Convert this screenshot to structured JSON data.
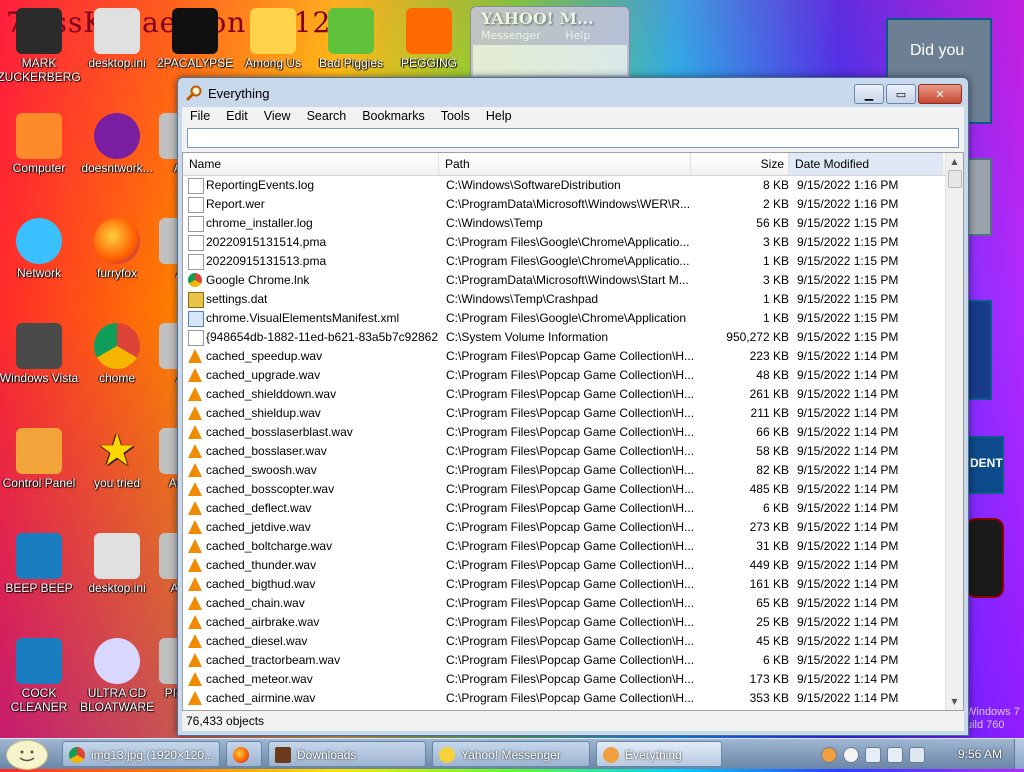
{
  "desktop": {
    "title_text": "7 ossKanae tion 2012",
    "icons": [
      {
        "label": "MARK ZUCKERBERG",
        "icon": "person-icon"
      },
      {
        "label": "desktop.ini",
        "icon": "settings-file-icon"
      },
      {
        "label": "2PACALYPSE",
        "icon": "cmd-icon"
      },
      {
        "label": "Among Us",
        "icon": "folder-icon"
      },
      {
        "label": "Bad Piggies",
        "icon": "pig-icon"
      },
      {
        "label": "PEGGING",
        "icon": "peggle-icon"
      },
      {
        "label": "Computer",
        "icon": "computer-icon"
      },
      {
        "label": "doesntwork...",
        "icon": "yahoo-icon"
      },
      {
        "label": "AN",
        "icon": "app-icon"
      },
      {
        "label": "Network",
        "icon": "network-icon"
      },
      {
        "label": "furryfox",
        "icon": "firefox-icon"
      },
      {
        "label": "Ar",
        "icon": "app-icon"
      },
      {
        "label": "Windows Vista",
        "icon": "recycle-bin-icon"
      },
      {
        "label": "chome",
        "icon": "chrome-icon"
      },
      {
        "label": "Ar",
        "icon": "app-icon"
      },
      {
        "label": "Control Panel",
        "icon": "control-panel-icon"
      },
      {
        "label": "you tried",
        "icon": "star-icon"
      },
      {
        "label": "Ar St",
        "icon": "app-icon"
      },
      {
        "label": "BEEP BEEP",
        "icon": "book-icon"
      },
      {
        "label": "desktop.ini",
        "icon": "settings-file-icon"
      },
      {
        "label": "Ar S",
        "icon": "app-icon"
      },
      {
        "label": "COCK CLEANER",
        "icon": "book-icon"
      },
      {
        "label": "ULTRA CD BLOATWARE",
        "icon": "cd-icon"
      },
      {
        "label": "PIS IN",
        "icon": "app-icon"
      }
    ],
    "right_texts": {
      "did_you": "Did you",
      "dent": "DENT",
      "win7": "Windows 7",
      "build": "uild 760"
    }
  },
  "yahoo_window": {
    "title": "YAHOO! M...",
    "menu": [
      "Messenger",
      "Help"
    ]
  },
  "window": {
    "title": "Everything",
    "menus": [
      "File",
      "Edit",
      "View",
      "Search",
      "Bookmarks",
      "Tools",
      "Help"
    ],
    "search": {
      "value": "",
      "placeholder": ""
    },
    "columns": {
      "name": "Name",
      "path": "Path",
      "size": "Size",
      "date": "Date Modified"
    },
    "rows": [
      {
        "name": "ReportingEvents.log",
        "path": "C:\\Windows\\SoftwareDistribution",
        "size": "8 KB",
        "date": "9/15/2022 1:16 PM",
        "icon": "log"
      },
      {
        "name": "Report.wer",
        "path": "C:\\ProgramData\\Microsoft\\Windows\\WER\\R...",
        "size": "2 KB",
        "date": "9/15/2022 1:16 PM",
        "icon": "log"
      },
      {
        "name": "chrome_installer.log",
        "path": "C:\\Windows\\Temp",
        "size": "56 KB",
        "date": "9/15/2022 1:15 PM",
        "icon": "log"
      },
      {
        "name": "20220915131514.pma",
        "path": "C:\\Program Files\\Google\\Chrome\\Applicatio...",
        "size": "3 KB",
        "date": "9/15/2022 1:15 PM",
        "icon": "log"
      },
      {
        "name": "20220915131513.pma",
        "path": "C:\\Program Files\\Google\\Chrome\\Applicatio...",
        "size": "1 KB",
        "date": "9/15/2022 1:15 PM",
        "icon": "log"
      },
      {
        "name": "Google Chrome.lnk",
        "path": "C:\\ProgramData\\Microsoft\\Windows\\Start M...",
        "size": "3 KB",
        "date": "9/15/2022 1:15 PM",
        "icon": "chrome"
      },
      {
        "name": "settings.dat",
        "path": "C:\\Windows\\Temp\\Crashpad",
        "size": "1 KB",
        "date": "9/15/2022 1:15 PM",
        "icon": "lock"
      },
      {
        "name": "chrome.VisualElementsManifest.xml",
        "path": "C:\\Program Files\\Google\\Chrome\\Application",
        "size": "1 KB",
        "date": "9/15/2022 1:15 PM",
        "icon": "xml"
      },
      {
        "name": "{948654db-1882-11ed-b621-83a5b7c92862...",
        "path": "C:\\System Volume Information",
        "size": "950,272 KB",
        "date": "9/15/2022 1:15 PM",
        "icon": "log"
      },
      {
        "name": "cached_speedup.wav",
        "path": "C:\\Program Files\\Popcap Game Collection\\H...",
        "size": "223 KB",
        "date": "9/15/2022 1:14 PM",
        "icon": "vlc"
      },
      {
        "name": "cached_upgrade.wav",
        "path": "C:\\Program Files\\Popcap Game Collection\\H...",
        "size": "48 KB",
        "date": "9/15/2022 1:14 PM",
        "icon": "vlc"
      },
      {
        "name": "cached_shielddown.wav",
        "path": "C:\\Program Files\\Popcap Game Collection\\H...",
        "size": "261 KB",
        "date": "9/15/2022 1:14 PM",
        "icon": "vlc"
      },
      {
        "name": "cached_shieldup.wav",
        "path": "C:\\Program Files\\Popcap Game Collection\\H...",
        "size": "211 KB",
        "date": "9/15/2022 1:14 PM",
        "icon": "vlc"
      },
      {
        "name": "cached_bosslaserblast.wav",
        "path": "C:\\Program Files\\Popcap Game Collection\\H...",
        "size": "66 KB",
        "date": "9/15/2022 1:14 PM",
        "icon": "vlc"
      },
      {
        "name": "cached_bosslaser.wav",
        "path": "C:\\Program Files\\Popcap Game Collection\\H...",
        "size": "58 KB",
        "date": "9/15/2022 1:14 PM",
        "icon": "vlc"
      },
      {
        "name": "cached_swoosh.wav",
        "path": "C:\\Program Files\\Popcap Game Collection\\H...",
        "size": "82 KB",
        "date": "9/15/2022 1:14 PM",
        "icon": "vlc"
      },
      {
        "name": "cached_bosscopter.wav",
        "path": "C:\\Program Files\\Popcap Game Collection\\H...",
        "size": "485 KB",
        "date": "9/15/2022 1:14 PM",
        "icon": "vlc"
      },
      {
        "name": "cached_deflect.wav",
        "path": "C:\\Program Files\\Popcap Game Collection\\H...",
        "size": "6 KB",
        "date": "9/15/2022 1:14 PM",
        "icon": "vlc"
      },
      {
        "name": "cached_jetdive.wav",
        "path": "C:\\Program Files\\Popcap Game Collection\\H...",
        "size": "273 KB",
        "date": "9/15/2022 1:14 PM",
        "icon": "vlc"
      },
      {
        "name": "cached_boltcharge.wav",
        "path": "C:\\Program Files\\Popcap Game Collection\\H...",
        "size": "31 KB",
        "date": "9/15/2022 1:14 PM",
        "icon": "vlc"
      },
      {
        "name": "cached_thunder.wav",
        "path": "C:\\Program Files\\Popcap Game Collection\\H...",
        "size": "449 KB",
        "date": "9/15/2022 1:14 PM",
        "icon": "vlc"
      },
      {
        "name": "cached_bigthud.wav",
        "path": "C:\\Program Files\\Popcap Game Collection\\H...",
        "size": "161 KB",
        "date": "9/15/2022 1:14 PM",
        "icon": "vlc"
      },
      {
        "name": "cached_chain.wav",
        "path": "C:\\Program Files\\Popcap Game Collection\\H...",
        "size": "65 KB",
        "date": "9/15/2022 1:14 PM",
        "icon": "vlc"
      },
      {
        "name": "cached_airbrake.wav",
        "path": "C:\\Program Files\\Popcap Game Collection\\H...",
        "size": "25 KB",
        "date": "9/15/2022 1:14 PM",
        "icon": "vlc"
      },
      {
        "name": "cached_diesel.wav",
        "path": "C:\\Program Files\\Popcap Game Collection\\H...",
        "size": "45 KB",
        "date": "9/15/2022 1:14 PM",
        "icon": "vlc"
      },
      {
        "name": "cached_tractorbeam.wav",
        "path": "C:\\Program Files\\Popcap Game Collection\\H...",
        "size": "6 KB",
        "date": "9/15/2022 1:14 PM",
        "icon": "vlc"
      },
      {
        "name": "cached_meteor.wav",
        "path": "C:\\Program Files\\Popcap Game Collection\\H...",
        "size": "173 KB",
        "date": "9/15/2022 1:14 PM",
        "icon": "vlc"
      },
      {
        "name": "cached_airmine.wav",
        "path": "C:\\Program Files\\Popcap Game Collection\\H...",
        "size": "353 KB",
        "date": "9/15/2022 1:14 PM",
        "icon": "vlc"
      }
    ],
    "status": "76,433 objects"
  },
  "taskbar": {
    "items": [
      {
        "label": "img13.jpg (1920×120...",
        "icon": "chrome-icon"
      },
      {
        "label": "",
        "icon": "firefox-icon"
      },
      {
        "label": "Downloads",
        "icon": "folder-icon"
      },
      {
        "label": "Yahoo! Messenger",
        "icon": "yahoo-icon"
      },
      {
        "label": "Everything",
        "icon": "search-icon"
      }
    ],
    "clock": "9:56 AM"
  }
}
